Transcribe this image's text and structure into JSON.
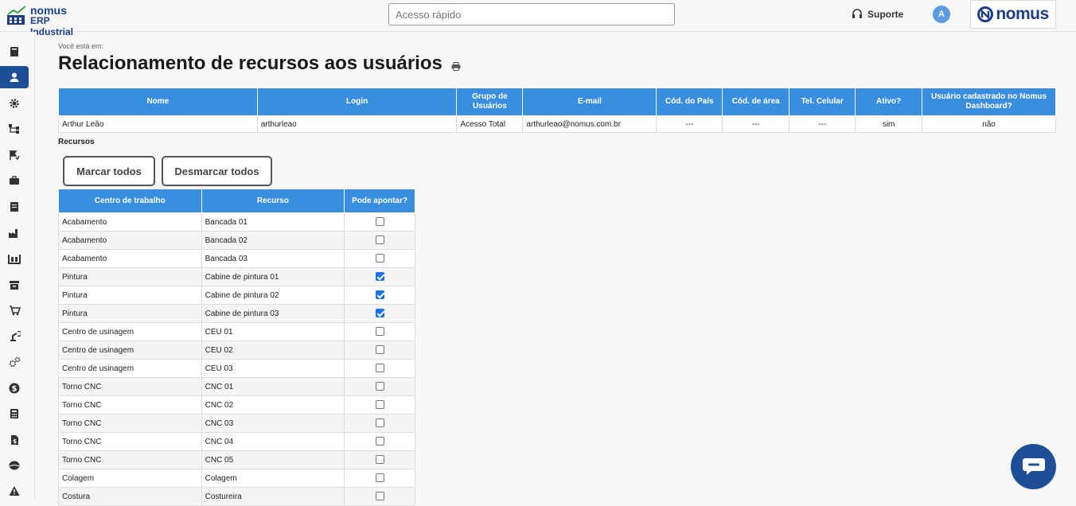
{
  "app": {
    "logo_line1": "nomus",
    "logo_line2": "ERP Industrial",
    "brand": "nomus"
  },
  "search": {
    "placeholder": "Acesso rápido"
  },
  "header": {
    "support_label": "Suporte",
    "avatar_initial": "A"
  },
  "sidebar": {
    "items": [
      "book-icon",
      "user-icon",
      "gear-icon",
      "hierarchy-icon",
      "flag-check-icon",
      "briefcase-icon",
      "document-icon",
      "factory-icon",
      "warehouse-icon",
      "archive-icon",
      "cart-icon",
      "robot-arm-icon",
      "gears-icon",
      "dollar-icon",
      "calculator-icon",
      "invoice-icon",
      "globe-icon",
      "warning-icon"
    ],
    "active_index": 1
  },
  "page": {
    "breadcrumb": "Você está em:",
    "title": "Relacionamento de recursos aos usuários"
  },
  "user_table": {
    "headers": [
      "Nome",
      "Login",
      "Grupo de Usuários",
      "E-mail",
      "Cód. do País",
      "Cód. de área",
      "Tel. Celular",
      "Ativo?",
      "Usuário cadastrado no Nomus Dashboard?"
    ],
    "row": [
      "Arthur Leão",
      "arthurleao",
      "Acesso Total",
      "arthurleao@nomus.com.br",
      "---",
      "---",
      "---",
      "sim",
      "não"
    ]
  },
  "resources": {
    "section_label": "Recursos",
    "select_all_label": "Marcar todos",
    "deselect_all_label": "Desmarcar todos",
    "headers": [
      "Centro de trabalho",
      "Recurso",
      "Pode apontar?"
    ],
    "rows": [
      {
        "center": "Acabamento",
        "resource": "Bancada 01",
        "checked": false
      },
      {
        "center": "Acabamento",
        "resource": "Bancada 02",
        "checked": false
      },
      {
        "center": "Acabamento",
        "resource": "Bancada 03",
        "checked": false
      },
      {
        "center": "Pintura",
        "resource": "Cabine de pintura 01",
        "checked": true
      },
      {
        "center": "Pintura",
        "resource": "Cabine de pintura 02",
        "checked": true
      },
      {
        "center": "Pintura",
        "resource": "Cabine de pintura 03",
        "checked": true
      },
      {
        "center": "Centro de usinagem",
        "resource": "CEU 01",
        "checked": false
      },
      {
        "center": "Centro de usinagem",
        "resource": "CEU 02",
        "checked": false
      },
      {
        "center": "Centro de usinagem",
        "resource": "CEU 03",
        "checked": false
      },
      {
        "center": "Torno CNC",
        "resource": "CNC 01",
        "checked": false
      },
      {
        "center": "Torno CNC",
        "resource": "CNC 02",
        "checked": false
      },
      {
        "center": "Torno CNC",
        "resource": "CNC 03",
        "checked": false
      },
      {
        "center": "Torno CNC",
        "resource": "CNC 04",
        "checked": false
      },
      {
        "center": "Torno CNC",
        "resource": "CNC 05",
        "checked": false
      },
      {
        "center": "Colagem",
        "resource": "Colagem",
        "checked": false
      },
      {
        "center": "Costura",
        "resource": "Costureira",
        "checked": false
      }
    ]
  },
  "colors": {
    "accent": "#3a8ee0",
    "brand": "#1d4e97",
    "checkbox_on": "#1a73e8"
  }
}
